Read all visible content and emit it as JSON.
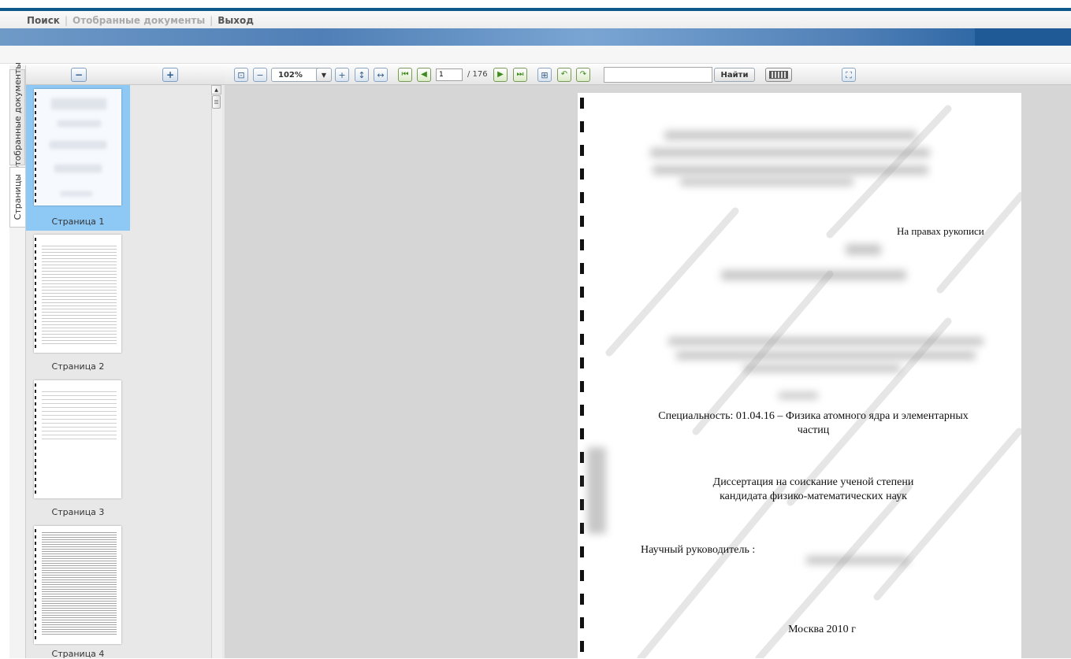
{
  "menu": {
    "search": "Поиск",
    "selected_docs": "Отобранные документы",
    "logout": "Выход"
  },
  "side_tabs": {
    "selected_documents": "Отобранные документы",
    "pages": "Страницы"
  },
  "thumbnails": [
    {
      "label": "Страница 1",
      "selected": true
    },
    {
      "label": "Страница 2",
      "selected": false
    },
    {
      "label": "Страница 3",
      "selected": false
    },
    {
      "label": "Страница 4",
      "selected": false
    }
  ],
  "toolbar": {
    "zoom": "102%",
    "current_page": "1",
    "total_pages": "/ 176",
    "search_value": "",
    "find_label": "Найти"
  },
  "document": {
    "rights": "На правах рукописи",
    "specialty_line1": "Специальность: 01.04.16 – Физика атомного ядра и элементарных",
    "specialty_line2": "частиц",
    "dissertation_line1": "Диссертация на соискание ученой степени",
    "dissertation_line2": "кандидата физико-математических наук",
    "supervisor": "Научный руководитель :",
    "city_year": "Москва 2010 г"
  },
  "colors": {
    "accent": "#0e5a8c",
    "selected_thumb": "#8ec8f4",
    "viewer_bg": "#d6d6d6"
  }
}
